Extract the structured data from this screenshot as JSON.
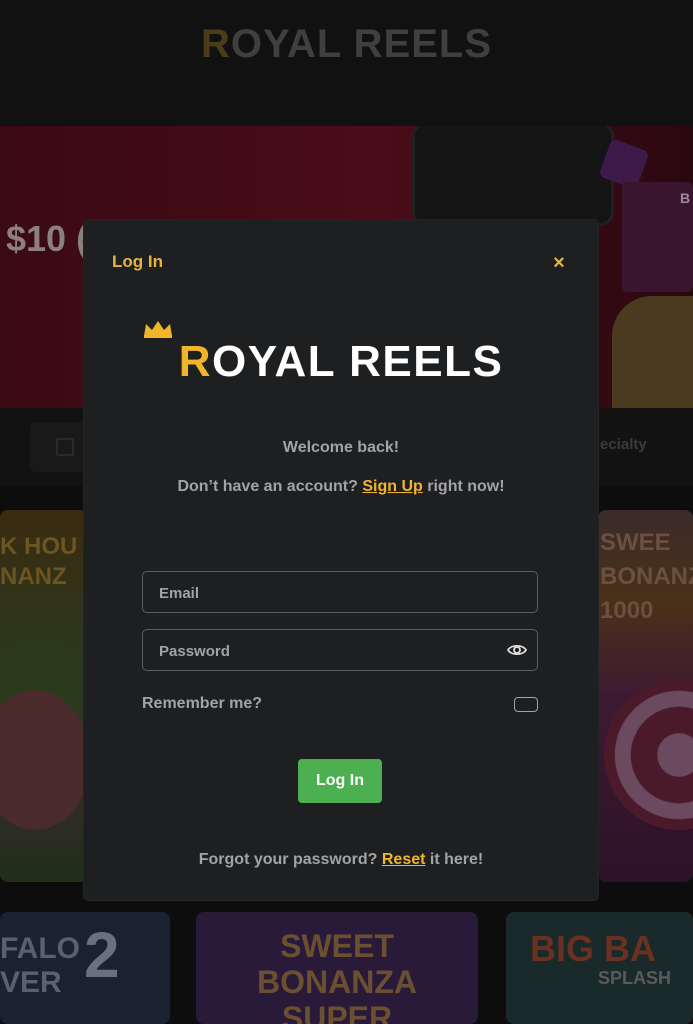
{
  "background": {
    "brand_first": "R",
    "brand_rest": "OYAL REELS",
    "promo_text": "$10 (",
    "right_card_text": "B",
    "tab_label": "ecialty",
    "games": [
      {
        "title": "K HOU\nNANZ"
      },
      {
        "title": "SWEE\nBONANZ\n1000"
      },
      {
        "title": "FALO\nVER",
        "badge": "2"
      },
      {
        "title": "SWEET\nBONANZA\nSUPER"
      },
      {
        "title": "BIG BA",
        "subtitle": "SPLASH"
      }
    ]
  },
  "modal": {
    "title": "Log In",
    "close_symbol": "×",
    "logo_first": "R",
    "logo_rest": "OYAL REELS",
    "welcome": "Welcome back!",
    "signup_prefix": "Don’t have an account?",
    "signup_link": "Sign Up",
    "signup_suffix": "right now!",
    "email_placeholder": "Email",
    "password_placeholder": "Password",
    "remember_label": "Remember me?",
    "login_button": "Log In",
    "forgot_prefix": "Forgot your password?",
    "forgot_link": "Reset",
    "forgot_suffix": "it here!"
  },
  "icons": {
    "close": "close-icon",
    "password_toggle": "eye-icon",
    "crown": "crown-icon"
  },
  "colors": {
    "accent_gold": "#f0b629",
    "login_green": "#4caf50",
    "modal_bg": "#1e1f21"
  }
}
